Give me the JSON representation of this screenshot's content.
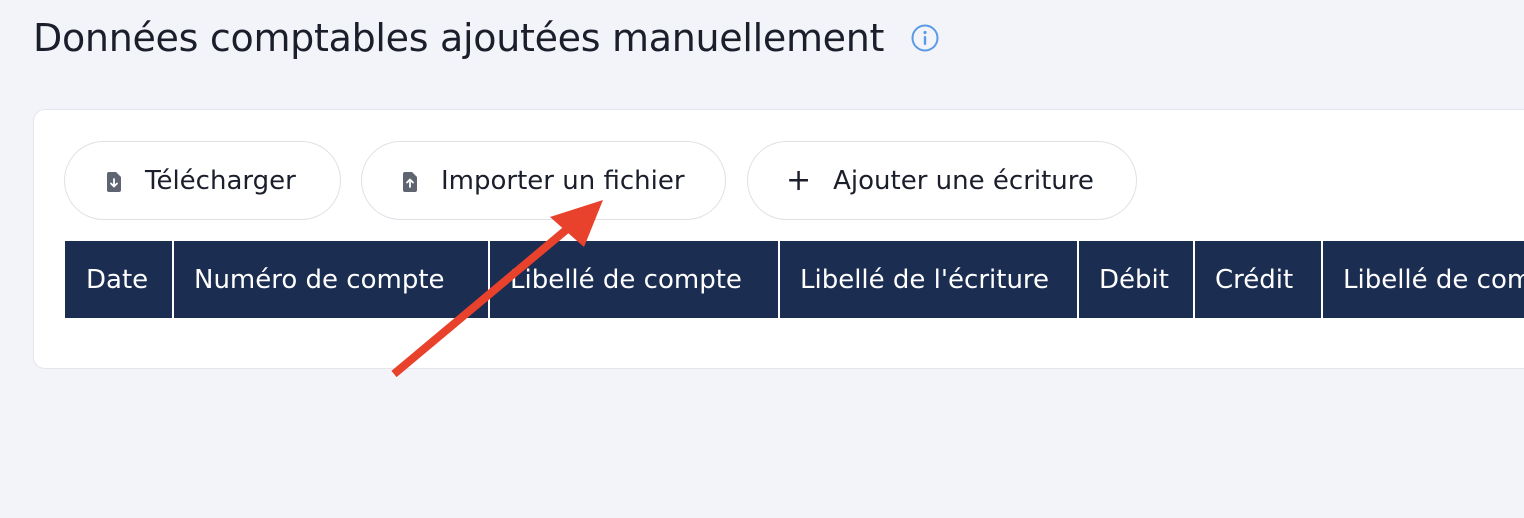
{
  "page": {
    "title": "Données comptables ajoutées manuellement",
    "info_icon": "info-circle-icon"
  },
  "toolbar": {
    "download_label": "Télécharger",
    "download_icon": "file-download-icon",
    "import_label": "Importer un fichier",
    "import_icon": "file-upload-icon",
    "add_label": "Ajouter une écriture",
    "add_icon": "plus-icon"
  },
  "table": {
    "columns": [
      "Date",
      "Numéro de compte",
      "Libellé de compte",
      "Libellé de l'écriture",
      "Débit",
      "Crédit",
      "Libellé de compte"
    ]
  },
  "annotation": {
    "color": "#e8412c"
  }
}
